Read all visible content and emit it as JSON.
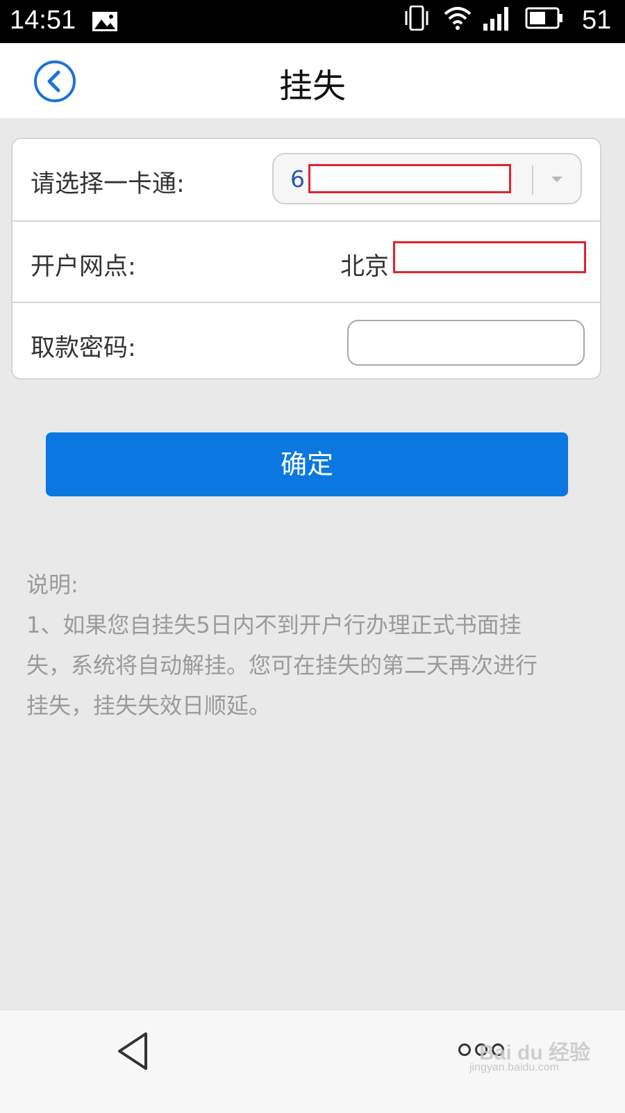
{
  "status_bar": {
    "time": "14:51",
    "battery": "51",
    "icons": [
      "gallery-icon",
      "vibrate-icon",
      "wifi-icon",
      "signal-icon",
      "battery-icon"
    ]
  },
  "header": {
    "title": "挂失",
    "back_icon": "back-circle-icon",
    "accent": "#1a73d8"
  },
  "form": {
    "card_label": "请选择一卡通:",
    "card_value": "6",
    "branch_label": "开户网点:",
    "branch_value": "北京",
    "password_label": "取款密码:",
    "password_value": ""
  },
  "confirm": {
    "label": "确定",
    "color": "#0a78e0"
  },
  "notes": {
    "heading": "说明:",
    "line1": "1、如果您自挂失5日内不到开户行办理正式书面挂",
    "line2": "失，系统将自动解挂。您可在挂失的第二天再次进行",
    "line3": "挂失，挂失失效日顺延。"
  },
  "nav_bar": {
    "back_icon": "triangle-back-icon",
    "menu_icon": "more-dots-icon"
  },
  "watermark": {
    "text": "Bai du 经验",
    "url_text": "jingyan.baidu.com"
  }
}
